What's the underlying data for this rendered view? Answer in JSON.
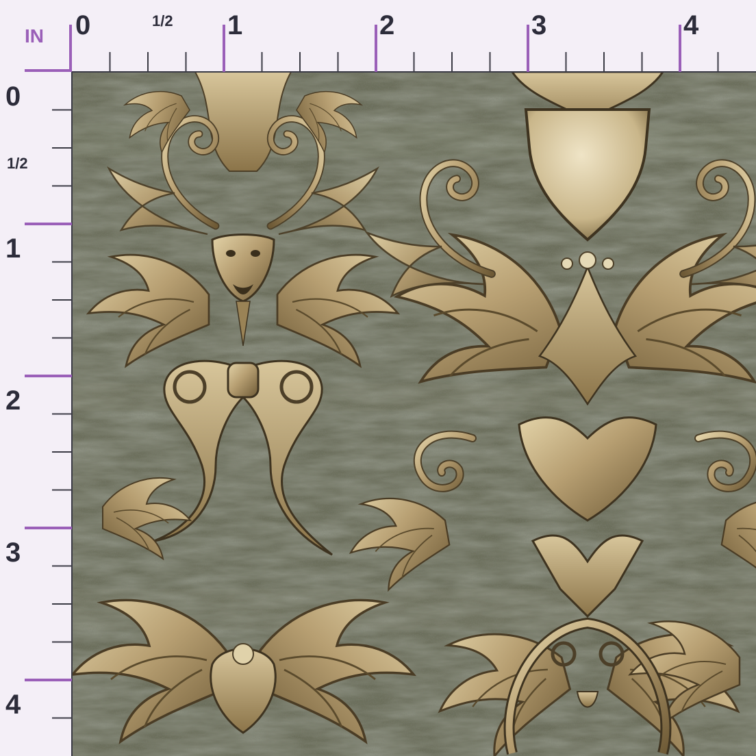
{
  "ruler": {
    "unit_label": "IN",
    "top_labels": [
      "0",
      "1/2",
      "1",
      "2",
      "3",
      "4"
    ],
    "left_labels": [
      "0",
      "1/2",
      "1",
      "2",
      "3",
      "4"
    ]
  },
  "colors": {
    "background": "#f4eff7",
    "accent": "#9a5fb8",
    "ruler_text": "#2c2c3a",
    "fabric_base": "#6c6f5c",
    "ornament_gold": "#b79f72",
    "ornament_dark": "#4c3f28"
  },
  "swatch": {
    "pattern": "baroque-gold-damask-ornaments"
  }
}
